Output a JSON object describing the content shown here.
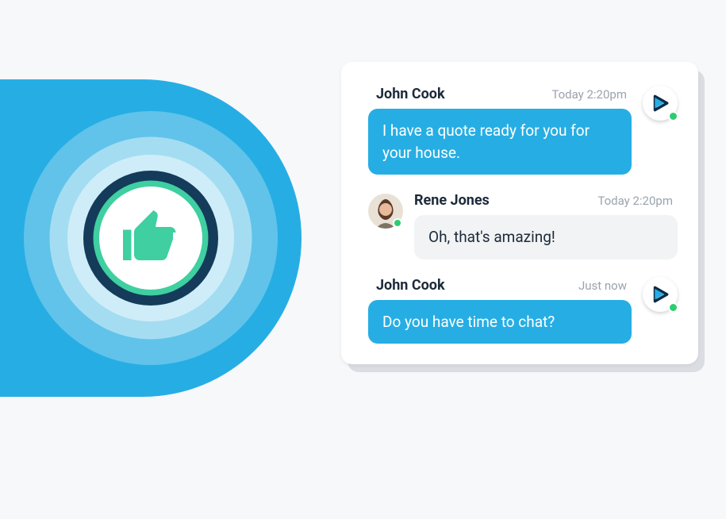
{
  "colors": {
    "accent": "#26aee4",
    "presence_online": "#2ecc71",
    "thumb": "#3fcfa1"
  },
  "messages": [
    {
      "sender": "John Cook",
      "time": "Today 2:20pm",
      "text": "I have a quote ready for you for your house.",
      "role": "agent"
    },
    {
      "sender": "Rene Jones",
      "time": "Today 2:20pm",
      "text": "Oh, that's amazing!",
      "role": "customer"
    },
    {
      "sender": "John Cook",
      "time": "Just now",
      "text": "Do you have time to chat?",
      "role": "agent"
    }
  ]
}
